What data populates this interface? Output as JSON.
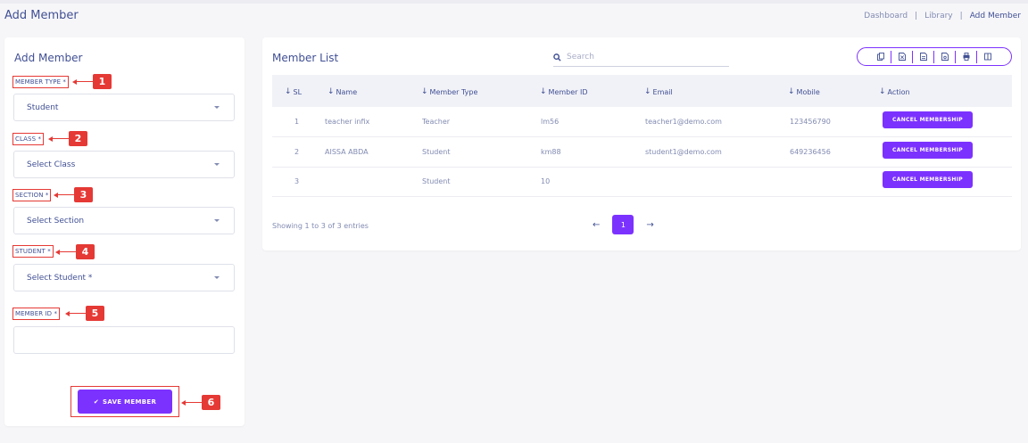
{
  "header": {
    "page_title": "Add Member",
    "breadcrumb": [
      "Dashboard",
      "Library",
      "Add Member"
    ],
    "breadcrumb_sep": "|"
  },
  "form": {
    "title": "Add Member",
    "fields": [
      {
        "label": "MEMBER TYPE *",
        "value": "Student",
        "callout": "1"
      },
      {
        "label": "CLASS *",
        "value": "Select Class",
        "callout": "2"
      },
      {
        "label": "SECTION *",
        "value": "Select Section",
        "callout": "3"
      },
      {
        "label": "STUDENT *",
        "value": "Select Student *",
        "callout": "4"
      },
      {
        "label": "MEMBER ID *",
        "value": "",
        "callout": "5"
      }
    ],
    "save_label": "SAVE MEMBER",
    "save_callout": "6"
  },
  "list": {
    "title": "Member List",
    "search_placeholder": "Search",
    "columns": [
      "SL",
      "Name",
      "Member Type",
      "Member ID",
      "Email",
      "Mobile",
      "Action"
    ],
    "rows": [
      {
        "sl": "1",
        "name": "teacher infix",
        "type": "Teacher",
        "member_id": "lm56",
        "email": "teacher1@demo.com",
        "mobile": "123456790",
        "action": "CANCEL MEMBERSHIP"
      },
      {
        "sl": "2",
        "name": "AISSA ABDA",
        "type": "Student",
        "member_id": "km88",
        "email": "student1@demo.com",
        "mobile": "649236456",
        "action": "CANCEL MEMBERSHIP"
      },
      {
        "sl": "3",
        "name": "",
        "type": "Student",
        "member_id": "10",
        "email": "",
        "mobile": "",
        "action": "CANCEL MEMBERSHIP"
      }
    ],
    "showing": "Showing 1 to 3 of 3 entries",
    "current_page": "1",
    "prev": "←",
    "next": "→",
    "sort_arrow": "↓"
  },
  "colors": {
    "accent": "#7c32ff",
    "callout": "#e53935",
    "text": "#415094"
  }
}
